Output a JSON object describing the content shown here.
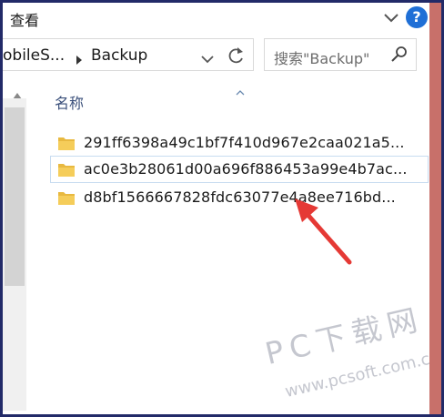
{
  "ribbon": {
    "view_label": "查看",
    "expand_icon": "chevron-down-icon",
    "help_glyph": "?"
  },
  "address": {
    "parent_crumb_partial": "obileS...",
    "current_crumb": "Backup",
    "separator_icon": "chevron-right-icon",
    "dropdown_icon": "chevron-down-icon",
    "refresh_icon": "refresh-icon"
  },
  "search": {
    "placeholder": "搜索\"Backup\"",
    "icon": "search-icon"
  },
  "file_list": {
    "column_header": "名称",
    "items": [
      {
        "name": "291ff6398a49c1bf7f410d967e2caa021a5...",
        "type": "folder",
        "selected": false
      },
      {
        "name": "ac0e3b28061d00a696f886453a99e4b7ac...",
        "type": "folder",
        "selected": true
      },
      {
        "name": "d8bf1566667828fdc63077e4a8ee716bd...",
        "type": "folder",
        "selected": false
      }
    ]
  },
  "watermark": {
    "brand": "PC下载网",
    "url": "www.pcsoft.com.cn"
  },
  "colors": {
    "frame": "#222a68",
    "accent_blue": "#1f6fd6",
    "folder_yellow": "#e8b940",
    "annotation_red": "#e53935",
    "right_strip": "#c8706a"
  }
}
